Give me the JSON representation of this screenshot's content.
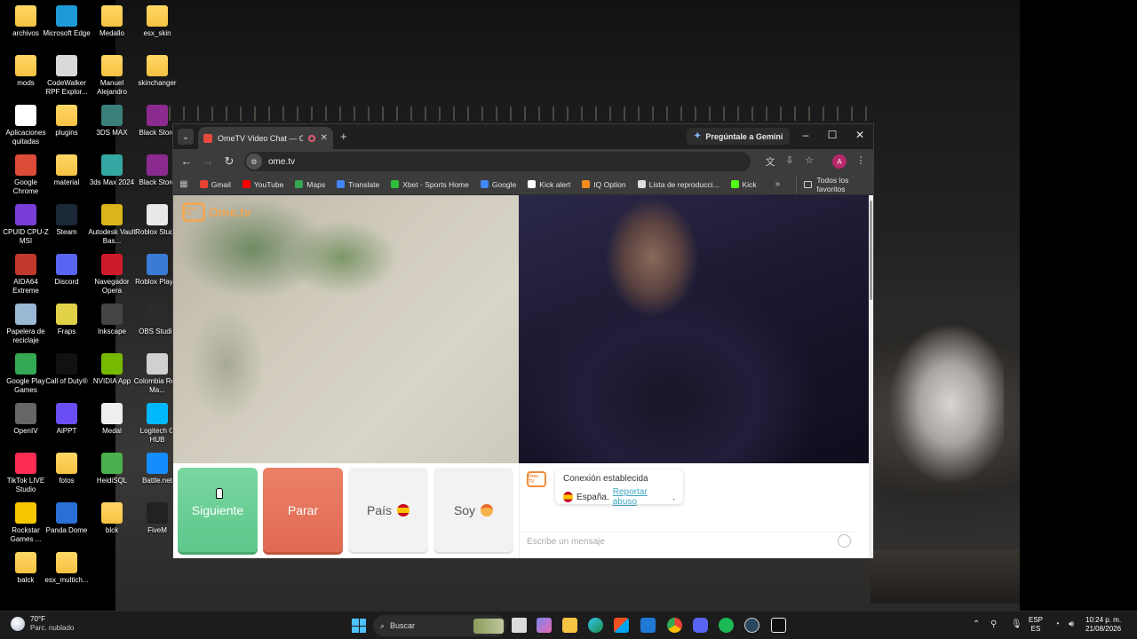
{
  "desktop": {
    "icons": [
      {
        "label": "archivos",
        "icon": "folder-icon"
      },
      {
        "label": "Microsoft Edge",
        "icon": "edge-icon"
      },
      {
        "label": "Medallo",
        "icon": "folder-icon"
      },
      {
        "label": "esx_skin",
        "icon": "folder-icon"
      },
      {
        "label": "mods",
        "icon": "folder-icon"
      },
      {
        "label": "CodeWalker RPF Explor...",
        "icon": "codewalker-icon"
      },
      {
        "label": "Manuel Alejandro",
        "icon": "folder-icon"
      },
      {
        "label": "skinchanger",
        "icon": "folder-icon"
      },
      {
        "label": "Aplicaciones quitadas",
        "icon": "html-file-icon"
      },
      {
        "label": "plugins",
        "icon": "folder-icon"
      },
      {
        "label": "3DS MAX",
        "icon": "3dsmax-icon"
      },
      {
        "label": "Black Store",
        "icon": "winrar-icon"
      },
      {
        "label": "Google Chrome",
        "icon": "chrome-icon"
      },
      {
        "label": "material",
        "icon": "folder-icon"
      },
      {
        "label": "3ds Max 2024",
        "icon": "3dsmax-2024-icon"
      },
      {
        "label": "Black Store",
        "icon": "winrar-icon"
      },
      {
        "label": "CPUID CPU-Z MSI",
        "icon": "cpuz-icon"
      },
      {
        "label": "Steam",
        "icon": "steam-icon"
      },
      {
        "label": "Autodesk Vault Bas...",
        "icon": "autodesk-vault-icon"
      },
      {
        "label": "Roblox Studio",
        "icon": "roblox-studio-icon"
      },
      {
        "label": "AIDA64 Extreme",
        "icon": "aida64-icon"
      },
      {
        "label": "Discord",
        "icon": "discord-icon"
      },
      {
        "label": "Navegador Opera",
        "icon": "opera-icon"
      },
      {
        "label": "Roblox Player",
        "icon": "roblox-player-icon"
      },
      {
        "label": "Papelera de reciclaje",
        "icon": "recycle-bin-icon"
      },
      {
        "label": "Fraps",
        "icon": "fraps-icon"
      },
      {
        "label": "Inkscape",
        "icon": "inkscape-icon"
      },
      {
        "label": "OBS Studio",
        "icon": "obs-icon"
      },
      {
        "label": "Google Play Games",
        "icon": "play-games-icon"
      },
      {
        "label": "Call of Duty®",
        "icon": "call-of-duty-icon"
      },
      {
        "label": "NVIDIA App",
        "icon": "nvidia-icon"
      },
      {
        "label": "Colombia Real Ma...",
        "icon": "colombia-real-map-icon"
      },
      {
        "label": "OpenIV",
        "icon": "openiv-icon"
      },
      {
        "label": "AiPPT",
        "icon": "aippt-icon"
      },
      {
        "label": "Medal",
        "icon": "medal-icon"
      },
      {
        "label": "Logitech G HUB",
        "icon": "logitech-ghub-icon"
      },
      {
        "label": "TikTok LIVE Studio",
        "icon": "tiktok-live-icon"
      },
      {
        "label": "fotos",
        "icon": "folder-icon"
      },
      {
        "label": "HeidiSQL",
        "icon": "heidisql-icon"
      },
      {
        "label": "Battle.net",
        "icon": "battlenet-icon"
      },
      {
        "label": "Rockstar Games ...",
        "icon": "rockstar-icon"
      },
      {
        "label": "Panda Dome",
        "icon": "panda-dome-icon"
      },
      {
        "label": "blck",
        "icon": "folder-icon"
      },
      {
        "label": "FiveM",
        "icon": "fivem-icon"
      },
      {
        "label": "balck",
        "icon": "folder-icon"
      },
      {
        "label": "esx_multich...",
        "icon": "folder-icon"
      }
    ]
  },
  "browser": {
    "tab_title": "OmeTV Video Chat — Ome",
    "new_tab": "+",
    "gemini_label": "Pregúntale a Gemini",
    "url": "ome.tv",
    "profile_initial": "A",
    "bookmarks": [
      {
        "label": "Gmail",
        "color": "#ea4335"
      },
      {
        "label": "YouTube",
        "color": "#ff0000"
      },
      {
        "label": "Maps",
        "color": "#34a853"
      },
      {
        "label": "Translate",
        "color": "#4285f4"
      },
      {
        "label": "Xbet - Sports Home",
        "color": "#2fbf3a"
      },
      {
        "label": "Google",
        "color": "#4285f4"
      },
      {
        "label": "Kick alert",
        "color": "#ffffff"
      },
      {
        "label": "IQ Option",
        "color": "#f58a1f"
      },
      {
        "label": "Lista de reproducci...",
        "color": "#dddddd"
      },
      {
        "label": "Kick",
        "color": "#53fc18"
      }
    ],
    "bookmarks_more": "»",
    "all_bookmarks": "Todos los favoritos"
  },
  "ometv": {
    "logo_text": "Ome.tv",
    "logo_box": "Ome TV",
    "buttons": {
      "next": "Siguiente",
      "stop": "Parar",
      "country": "País",
      "me": "Soy"
    },
    "chat": {
      "status": "Conexión establecida",
      "country": "España.",
      "report": "Reportar abuso",
      "report_suffix": ".",
      "placeholder": "Escribe un mensaje"
    }
  },
  "taskbar": {
    "weather_temp": "70°F",
    "weather_desc": "Parc. nublado",
    "search_label": "Buscar",
    "lang_top": "ESP",
    "lang_bottom": "ES",
    "time": "10:24 p. m.",
    "date": "21/08/2026",
    "apps": [
      "search-highlight",
      "task-view",
      "teams",
      "file-explorer",
      "edge",
      "microsoft-store",
      "outlook",
      "chrome",
      "discord",
      "spotify",
      "steam",
      "capcut"
    ]
  },
  "colors": {
    "next_green": "#5dc78a",
    "stop_red": "#e06a52",
    "ome_orange": "#f5a650",
    "report_link": "#3ea7c4"
  }
}
